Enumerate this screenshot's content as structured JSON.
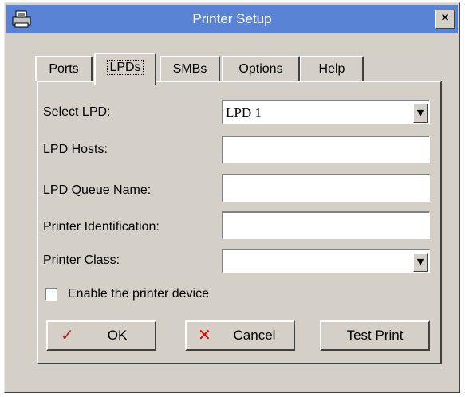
{
  "window": {
    "title": "Printer Setup",
    "close_label": "×"
  },
  "tabs": [
    {
      "label": "Ports",
      "active": false
    },
    {
      "label": "LPDs",
      "active": true
    },
    {
      "label": "SMBs",
      "active": false
    },
    {
      "label": "Options",
      "active": false
    },
    {
      "label": "Help",
      "active": false
    }
  ],
  "form": {
    "select_lpd_label": "Select LPD:",
    "select_lpd_value": "LPD 1",
    "lpd_hosts_label": "LPD Hosts:",
    "lpd_hosts_value": "",
    "queue_name_label": "LPD Queue Name:",
    "queue_name_value": "",
    "printer_id_label": "Printer Identification:",
    "printer_id_value": "",
    "printer_class_label": "Printer Class:",
    "printer_class_value": "",
    "enable_label": "Enable the printer device",
    "enable_checked": false
  },
  "buttons": {
    "ok": "OK",
    "cancel": "Cancel",
    "test_print": "Test Print"
  },
  "colors": {
    "titlebar": "#5a83d6",
    "dialog": "#d4d0c8",
    "ok_check": "#b22222",
    "cancel_x": "#e00000"
  },
  "icons": [
    "printer-icon",
    "close-icon",
    "dropdown-arrow-icon",
    "check-icon",
    "x-icon"
  ]
}
